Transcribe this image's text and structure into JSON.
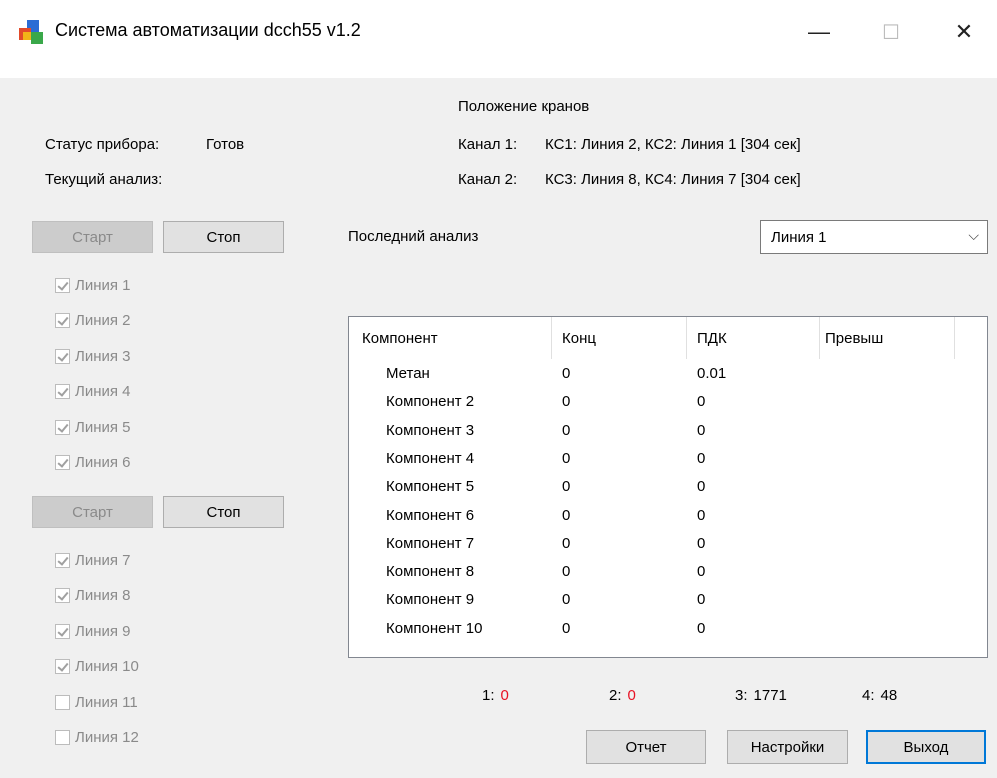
{
  "window": {
    "title": "Система автоматизации dcch55 v1.2",
    "minimize_glyph": "—",
    "maximize_glyph": "☐",
    "close_glyph": "✕"
  },
  "status": {
    "device_label": "Статус прибора:",
    "device_value": "Готов",
    "analysis_label": "Текущий анализ:",
    "analysis_value": ""
  },
  "valves": {
    "title": "Положение кранов",
    "channel1_label": "Канал 1:",
    "channel1_value": "КС1: Линия 2, КС2: Линия 1 [304 сек]",
    "channel2_label": "Канал 2:",
    "channel2_value": "КС3: Линия 8, КС4: Линия 7 [304 сек]"
  },
  "group1": {
    "start_label": "Старт",
    "stop_label": "Стоп",
    "lines": [
      {
        "label": "Линия 1",
        "checked": true
      },
      {
        "label": "Линия 2",
        "checked": true
      },
      {
        "label": "Линия 3",
        "checked": true
      },
      {
        "label": "Линия 4",
        "checked": true
      },
      {
        "label": "Линия 5",
        "checked": true
      },
      {
        "label": "Линия 6",
        "checked": true
      }
    ]
  },
  "group2": {
    "start_label": "Старт",
    "stop_label": "Стоп",
    "lines": [
      {
        "label": "Линия 7",
        "checked": true
      },
      {
        "label": "Линия 8",
        "checked": true
      },
      {
        "label": "Линия 9",
        "checked": true
      },
      {
        "label": "Линия 10",
        "checked": true
      },
      {
        "label": "Линия 11",
        "checked": false
      },
      {
        "label": "Линия 12",
        "checked": false
      }
    ]
  },
  "last_analysis": {
    "label": "Последний анализ",
    "selected_line": "Линия 1"
  },
  "table": {
    "columns": [
      "Компонент",
      "Конц",
      "ПДК",
      "Превыш"
    ],
    "rows": [
      [
        "Метан",
        "0",
        "0.01",
        ""
      ],
      [
        "Компонент 2",
        "0",
        "0",
        ""
      ],
      [
        "Компонент 3",
        "0",
        "0",
        ""
      ],
      [
        "Компонент 4",
        "0",
        "0",
        ""
      ],
      [
        "Компонент 5",
        "0",
        "0",
        ""
      ],
      [
        "Компонент 6",
        "0",
        "0",
        ""
      ],
      [
        "Компонент 7",
        "0",
        "0",
        ""
      ],
      [
        "Компонент 8",
        "0",
        "0",
        ""
      ],
      [
        "Компонент 9",
        "0",
        "0",
        ""
      ],
      [
        "Компонент 10",
        "0",
        "0",
        ""
      ]
    ]
  },
  "counters": [
    {
      "label": "1:",
      "value": "0",
      "red": true
    },
    {
      "label": "2:",
      "value": "0",
      "red": true
    },
    {
      "label": "3:",
      "value": "1771",
      "red": false
    },
    {
      "label": "4:",
      "value": "48",
      "red": false
    }
  ],
  "buttons": {
    "report": "Отчет",
    "settings": "Настройки",
    "exit": "Выход"
  },
  "colors": {
    "accent": "#0078d7",
    "alert": "#e81123"
  }
}
